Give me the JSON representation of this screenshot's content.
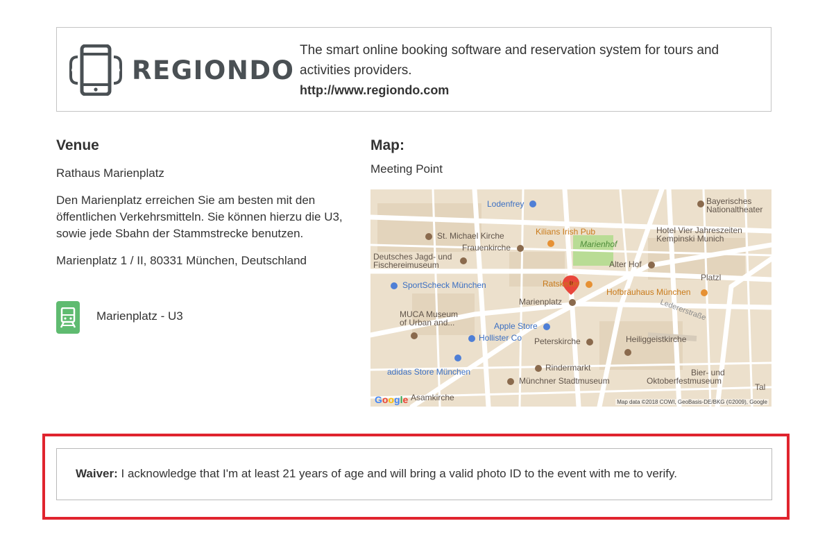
{
  "provider": {
    "logo_text": "REGIONDO",
    "description": "The smart online booking software and reservation system for tours and activities providers.",
    "url": "http://www.regiondo.com"
  },
  "venue": {
    "heading": "Venue",
    "name": "Rathaus Marienplatz",
    "description": "Den Marienplatz erreichen Sie am besten mit den öffentlichen Verkehrsmitteln. Sie können hierzu die U3, sowie jede Sbahn der Stammstrecke benutzen.",
    "address": "Marienplatz 1 / II, 80331 München, Deutschland",
    "transit": {
      "label": "Marienplatz - U3",
      "icon": "train-icon",
      "color": "#5fbb70"
    }
  },
  "map": {
    "heading": "Map:",
    "subtitle": "Meeting Point",
    "labels": {
      "lodenfrey": "Lodenfrey",
      "bayerisches": "Bayerisches",
      "nationaltheater": "Nationaltheater",
      "st_michael": "St. Michael Kirche",
      "kilians": "Kilians Irish Pub",
      "hotel_vier_1": "Hotel Vier Jahreszeiten",
      "hotel_vier_2": "Kempinski Munich",
      "frauenkirche": "Frauenkirche",
      "marienhof": "Marienhof",
      "deutsches_1": "Deutsches Jagd- und",
      "deutsches_2": "Fischereimuseum",
      "alter_hof": "Alter Hof",
      "platzl": "Platzl",
      "sportscheck": "SportScheck München",
      "ratskeller": "Ratskeller",
      "hofbraeuhaus": "Hofbräuhaus München",
      "marienplatz": "Marienplatz",
      "ledererstrasse": "Ledererstraße",
      "muca_1": "MUCA Museum",
      "muca_2": "of Urban and...",
      "apple": "Apple Store",
      "hollister": "Hollister Co",
      "peterskirche": "Peterskirche",
      "heiliggeist": "Heiliggeistkirche",
      "rindermarkt": "Rindermarkt",
      "bier_1": "Bier- und",
      "bier_2": "Oktoberfestmuseum",
      "adidas": "adidas Store München",
      "stadtmuseum": "Münchner Stadtmuseum",
      "asamkirche": "Asamkirche",
      "google": "Google",
      "tal": "Tal"
    },
    "attribution": "Map data ©2018 COWI, GeoBasis-DE/BKG (©2009), Google",
    "colors": {
      "land": "#ece0cc",
      "road": "#ffffff",
      "park": "#b9dc95",
      "pin": "#e8463b",
      "blue_poi": "#4f7fd6",
      "orange_poi": "#e69134",
      "brown_poi": "#8a6a4d"
    }
  },
  "waiver": {
    "label": "Waiver:",
    "text": " I acknowledge that I'm at least 21 years of age and will bring a valid photo ID to the event with me to verify.",
    "highlight_color": "#e0242e"
  }
}
